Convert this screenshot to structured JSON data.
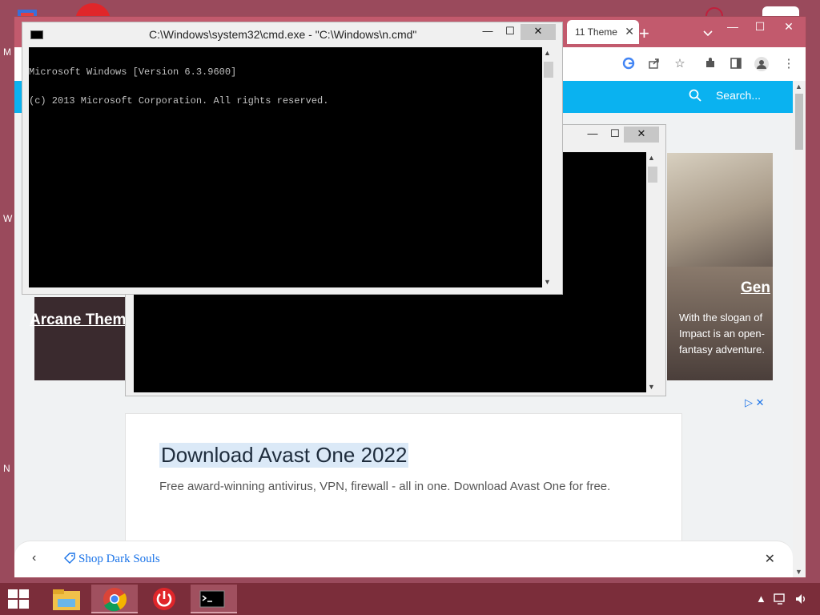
{
  "desktop": {
    "letters": [
      "M",
      "W",
      "N"
    ]
  },
  "chrome": {
    "tab_title": "11 Theme",
    "new_tab": "+",
    "dropdown": "⌄",
    "minimize": "—",
    "maximize": "☐",
    "close": "✕",
    "site_search_placeholder": "Search...",
    "card_left_title": "Arcane Them",
    "card_right_title": "Gen",
    "card_right_desc": "With the slogan of Impact is an open-fantasy adventure.",
    "ad_title": "Download Avast One 2022",
    "ad_desc": "Free award-winning antivirus, VPN, firewall - all in one. Download Avast One for free.",
    "bottom_bar_label": "Shop Dark Souls"
  },
  "cmd_front": {
    "title": "C:\\Windows\\system32\\cmd.exe - \"C:\\Windows\\n.cmd\"",
    "line1": "Microsoft Windows [Version 6.3.9600]",
    "line2": "(c) 2013 Microsoft Corporation. All rights reserved."
  },
  "cmd_back": {
    "title": ""
  },
  "taskbar": {
    "apps": [
      "start",
      "file-explorer",
      "chrome",
      "power",
      "cmd"
    ]
  },
  "colors": {
    "desktop": "#9a4a5c",
    "taskbar": "#7b2d3a",
    "site_header": "#0ab2f0",
    "ad_title_highlight": "#dbe9f7"
  }
}
